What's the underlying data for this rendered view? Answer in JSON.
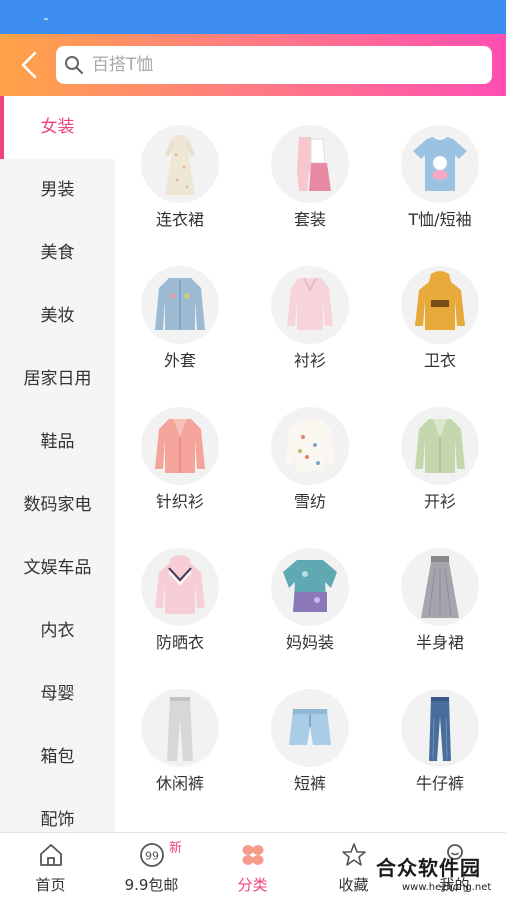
{
  "search": {
    "placeholder": "百搭T恤"
  },
  "sidebar": {
    "items": [
      {
        "label": "女装",
        "active": true
      },
      {
        "label": "男装"
      },
      {
        "label": "美食"
      },
      {
        "label": "美妆"
      },
      {
        "label": "居家日用"
      },
      {
        "label": "鞋品"
      },
      {
        "label": "数码家电"
      },
      {
        "label": "文娱车品"
      },
      {
        "label": "内衣"
      },
      {
        "label": "母婴"
      },
      {
        "label": "箱包"
      },
      {
        "label": "配饰"
      }
    ]
  },
  "categories": [
    {
      "label": "连衣裙",
      "icon": "dress-icon"
    },
    {
      "label": "套装",
      "icon": "outfit-set-icon"
    },
    {
      "label": "T恤/短袖",
      "icon": "tshirt-icon"
    },
    {
      "label": "外套",
      "icon": "denim-jacket-icon"
    },
    {
      "label": "衬衫",
      "icon": "blouse-icon"
    },
    {
      "label": "卫衣",
      "icon": "hoodie-icon"
    },
    {
      "label": "针织衫",
      "icon": "cardigan-icon"
    },
    {
      "label": "雪纺",
      "icon": "chiffon-icon"
    },
    {
      "label": "开衫",
      "icon": "open-cardigan-icon"
    },
    {
      "label": "防晒衣",
      "icon": "sun-protection-jacket-icon"
    },
    {
      "label": "妈妈装",
      "icon": "mom-top-icon"
    },
    {
      "label": "半身裙",
      "icon": "skirt-icon"
    },
    {
      "label": "休闲裤",
      "icon": "casual-pants-icon"
    },
    {
      "label": "短裤",
      "icon": "shorts-icon"
    },
    {
      "label": "牛仔裤",
      "icon": "jeans-icon"
    }
  ],
  "tabbar": {
    "tabs": [
      {
        "label": "首页",
        "icon": "home-icon"
      },
      {
        "label": "9.9包邮",
        "icon": "nine-nine-icon",
        "badge": "新"
      },
      {
        "label": "分类",
        "icon": "category-icon",
        "active": true
      },
      {
        "label": "收藏",
        "icon": "star-icon"
      },
      {
        "label": "我的",
        "icon": "profile-icon"
      }
    ]
  },
  "watermark": {
    "title": "合众软件园",
    "url": "www.hezhong.net"
  },
  "colors": {
    "accent": "#f0437e",
    "status_bar": "#3d8ef0",
    "gradient_start": "#ffa347",
    "gradient_end": "#ff4fb2"
  }
}
